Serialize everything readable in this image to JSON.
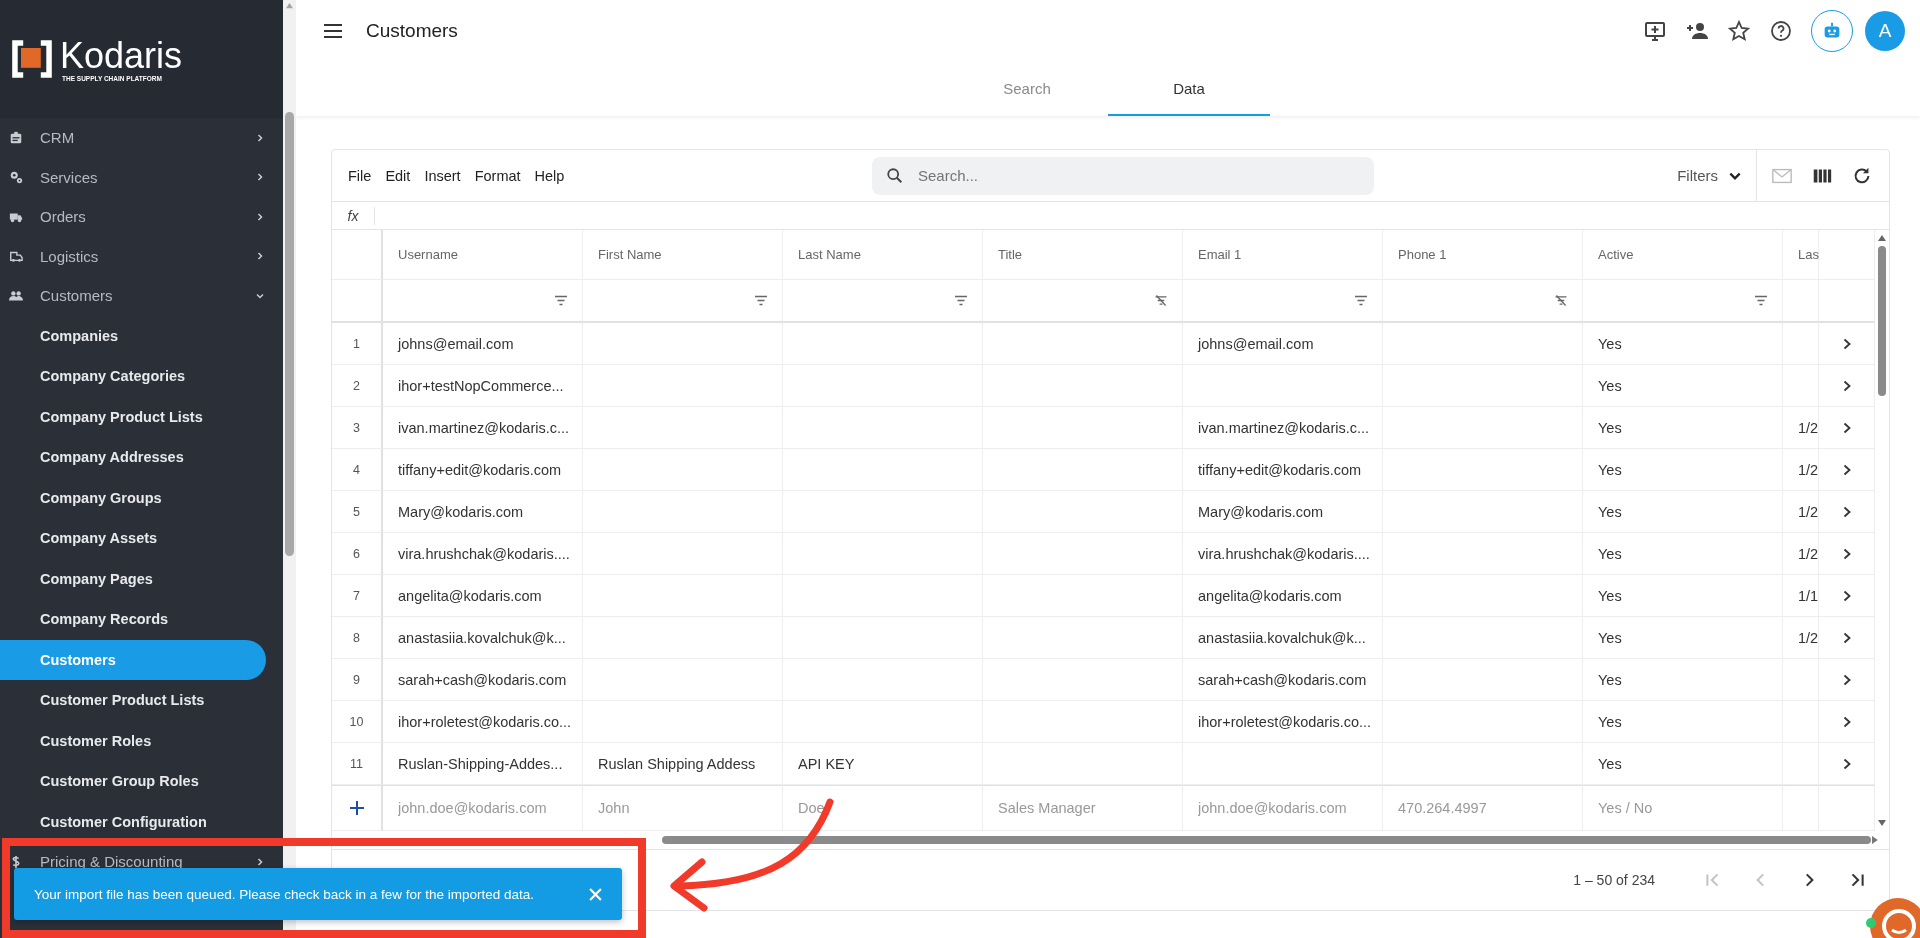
{
  "sidebar": {
    "logo": {
      "name": "Kodaris",
      "tagline": "THE SUPPLY CHAIN PLATFORM"
    },
    "sections": [
      {
        "label": "CRM",
        "expanded": false
      },
      {
        "label": "Services",
        "expanded": false
      },
      {
        "label": "Orders",
        "expanded": false
      },
      {
        "label": "Logistics",
        "expanded": false
      },
      {
        "label": "Customers",
        "expanded": true,
        "children": [
          {
            "label": "Companies",
            "selected": false
          },
          {
            "label": "Company Categories",
            "selected": false
          },
          {
            "label": "Company Product Lists",
            "selected": false
          },
          {
            "label": "Company Addresses",
            "selected": false
          },
          {
            "label": "Company Groups",
            "selected": false
          },
          {
            "label": "Company Assets",
            "selected": false
          },
          {
            "label": "Company Pages",
            "selected": false
          },
          {
            "label": "Company Records",
            "selected": false
          },
          {
            "label": "Customers",
            "selected": true
          },
          {
            "label": "Customer Product Lists",
            "selected": false
          },
          {
            "label": "Customer Roles",
            "selected": false
          },
          {
            "label": "Customer Group Roles",
            "selected": false
          },
          {
            "label": "Customer Configuration",
            "selected": false
          }
        ]
      },
      {
        "label": "Pricing & Discounting",
        "expanded": false
      }
    ]
  },
  "header": {
    "title": "Customers",
    "avatar": "A"
  },
  "tabs": [
    {
      "label": "Search",
      "selected": false
    },
    {
      "label": "Data",
      "selected": true
    }
  ],
  "toolbar": {
    "menu": [
      "File",
      "Edit",
      "Insert",
      "Format",
      "Help"
    ],
    "search": {
      "placeholder": "Search..."
    },
    "filters": "Filters",
    "formula_label": "fx"
  },
  "table": {
    "columns": [
      {
        "label": "Username",
        "filter_off": false
      },
      {
        "label": "First Name",
        "filter_off": false
      },
      {
        "label": "Last Name",
        "filter_off": false
      },
      {
        "label": "Title",
        "filter_off": true
      },
      {
        "label": "Email 1",
        "filter_off": false
      },
      {
        "label": "Phone 1",
        "filter_off": true
      },
      {
        "label": "Active",
        "filter_off": false
      },
      {
        "label": "Las"
      }
    ],
    "rows": [
      {
        "number": "1",
        "cells": [
          "johns@email.com",
          null,
          null,
          null,
          "johns@email.com",
          null,
          "Yes",
          null
        ]
      },
      {
        "number": "2",
        "cells": [
          "ihor+testNopCommerce...",
          null,
          null,
          null,
          null,
          null,
          "Yes",
          null
        ]
      },
      {
        "number": "3",
        "cells": [
          "ivan.martinez@kodaris.c...",
          null,
          null,
          null,
          "ivan.martinez@kodaris.c...",
          null,
          "Yes",
          "1/2"
        ]
      },
      {
        "number": "4",
        "cells": [
          "tiffany+edit@kodaris.com",
          null,
          null,
          null,
          "tiffany+edit@kodaris.com",
          null,
          "Yes",
          "1/2"
        ]
      },
      {
        "number": "5",
        "cells": [
          "Mary@kodaris.com",
          null,
          null,
          null,
          "Mary@kodaris.com",
          null,
          "Yes",
          "1/2"
        ]
      },
      {
        "number": "6",
        "cells": [
          "vira.hrushchak@kodaris....",
          null,
          null,
          null,
          "vira.hrushchak@kodaris....",
          null,
          "Yes",
          "1/2"
        ]
      },
      {
        "number": "7",
        "cells": [
          "angelita@kodaris.com",
          null,
          null,
          null,
          "angelita@kodaris.com",
          null,
          "Yes",
          "1/1"
        ]
      },
      {
        "number": "8",
        "cells": [
          "anastasiia.kovalchuk@k...",
          null,
          null,
          null,
          "anastasiia.kovalchuk@k...",
          null,
          "Yes",
          "1/2"
        ]
      },
      {
        "number": "9",
        "cells": [
          "sarah+cash@kodaris.com",
          null,
          null,
          null,
          "sarah+cash@kodaris.com",
          null,
          "Yes",
          null
        ]
      },
      {
        "number": "10",
        "cells": [
          "ihor+roletest@kodaris.co...",
          null,
          null,
          null,
          "ihor+roletest@kodaris.co...",
          null,
          "Yes",
          null
        ]
      },
      {
        "number": "11",
        "cells": [
          "Ruslan-Shipping-Addes...",
          "Ruslan Shipping Addess",
          "API KEY",
          null,
          null,
          null,
          "Yes",
          null
        ]
      }
    ],
    "new_row": [
      {
        "placeholder": "john.doe@kodaris.com"
      },
      {
        "placeholder": "John"
      },
      {
        "placeholder": "Doe"
      },
      {
        "placeholder": "Sales Manager"
      },
      {
        "placeholder": "john.doe@kodaris.com"
      },
      {
        "placeholder": "470.264.4997"
      },
      {
        "placeholder": "Yes / No"
      }
    ]
  },
  "pagination": {
    "range": "1 – 50 of 234",
    "buttons": [
      {
        "disabled": true
      },
      {
        "disabled": true
      },
      {
        "disabled": false
      },
      {
        "disabled": false
      }
    ]
  },
  "toast": {
    "message": "Your import file has been queued. Please check back in a few for the imported data."
  }
}
